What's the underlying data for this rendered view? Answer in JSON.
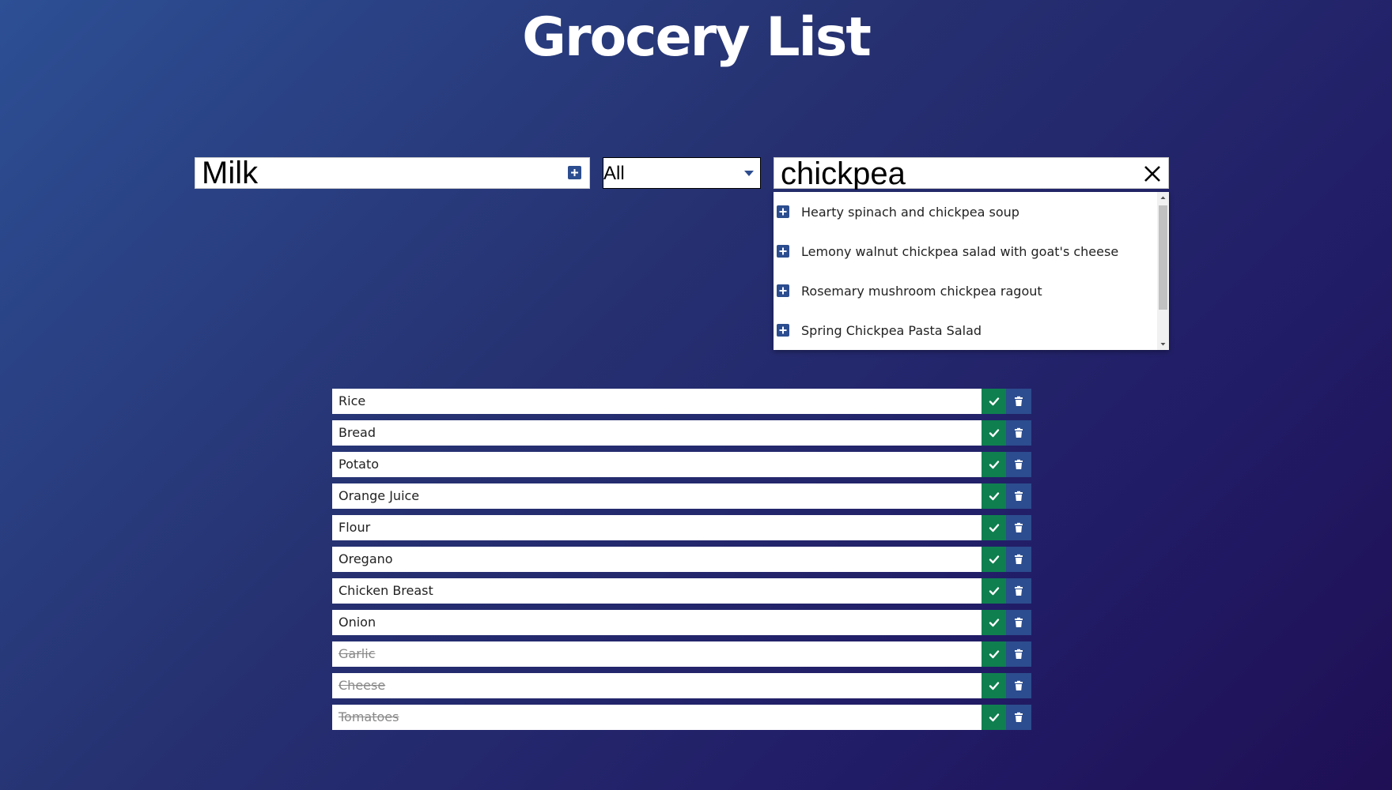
{
  "header": {
    "title": "Grocery List"
  },
  "add_item": {
    "value": "Milk",
    "button_icon": "plus-square-icon"
  },
  "filter": {
    "selected": "All",
    "icon": "caret-down-icon"
  },
  "search": {
    "value": "chickpea",
    "clear_icon": "close-icon"
  },
  "suggestions": [
    {
      "label": "Hearty spinach and chickpea soup"
    },
    {
      "label": "Lemony walnut chickpea salad with goat's cheese"
    },
    {
      "label": "Rosemary mushroom chickpea ragout"
    },
    {
      "label": "Spring Chickpea Pasta Salad"
    }
  ],
  "items": [
    {
      "name": "Rice",
      "done": false
    },
    {
      "name": "Bread",
      "done": false
    },
    {
      "name": "Potato",
      "done": false
    },
    {
      "name": "Orange Juice",
      "done": false
    },
    {
      "name": "Flour",
      "done": false
    },
    {
      "name": "Oregano",
      "done": false
    },
    {
      "name": "Chicken Breast",
      "done": false
    },
    {
      "name": "Onion",
      "done": false
    },
    {
      "name": "Garlic",
      "done": true
    },
    {
      "name": "Cheese",
      "done": true
    },
    {
      "name": "Tomatoes",
      "done": true
    }
  ],
  "colors": {
    "accent": "#2c4d8f",
    "check": "#0f7f4f"
  }
}
